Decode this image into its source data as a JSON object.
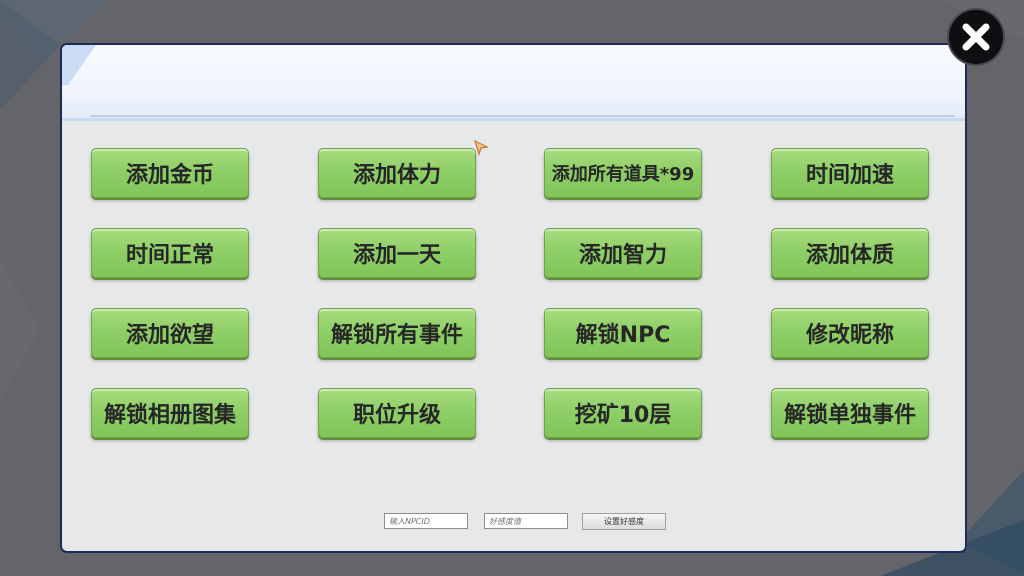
{
  "colors": {
    "background": "#63656a",
    "panel_border": "#1e2b57",
    "panel_body": "#e6e8e9",
    "button_green": "#8fcf67",
    "button_text": "#262626"
  },
  "buttons": [
    {
      "label": "添加金币"
    },
    {
      "label": "添加体力"
    },
    {
      "label": "添加所有道具*99"
    },
    {
      "label": "时间加速"
    },
    {
      "label": "时间正常"
    },
    {
      "label": "添加一天"
    },
    {
      "label": "添加智力"
    },
    {
      "label": "添加体质"
    },
    {
      "label": "添加欲望"
    },
    {
      "label": "解锁所有事件"
    },
    {
      "label": "解锁NPC"
    },
    {
      "label": "修改昵称"
    },
    {
      "label": "解锁相册图集"
    },
    {
      "label": "职位升级"
    },
    {
      "label": "挖矿10层"
    },
    {
      "label": "解锁单独事件"
    }
  ],
  "favor_form": {
    "npc_id_placeholder": "输入NPCID",
    "favor_value_placeholder": "好感度值",
    "submit_label": "设置好感度"
  },
  "icons": {
    "close": "close-icon",
    "cursor": "mouse-cursor-icon"
  }
}
